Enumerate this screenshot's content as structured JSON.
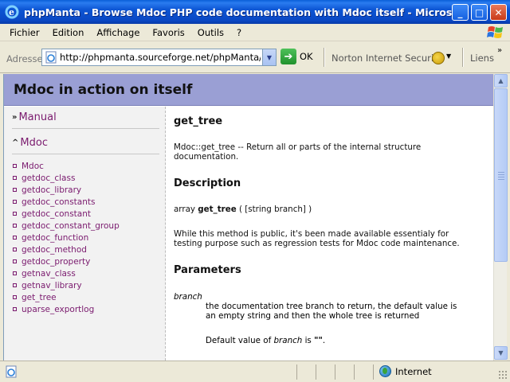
{
  "window": {
    "title": "phpManta - Browse Mdoc PHP code documentation with Mdoc itself - Microsoft Inter...",
    "buttons": {
      "minimize": "_",
      "maximize": "□",
      "close": "✕"
    }
  },
  "menubar": {
    "items": [
      "Fichier",
      "Edition",
      "Affichage",
      "Favoris",
      "Outils",
      "?"
    ]
  },
  "addressbar": {
    "label": "Adresse",
    "url": "http://phpmanta.sourceforge.net/phpManta/Mdoc/a",
    "go_label": "OK",
    "norton_label": "Norton Internet Security",
    "links_label": "Liens",
    "links_chevron": "»"
  },
  "page": {
    "header_title": "Mdoc in action on itself",
    "sidebar": {
      "manual_label": "Manual",
      "manual_glyph": "»",
      "mdoc_label": "Mdoc",
      "mdoc_glyph": "^",
      "items": [
        "Mdoc",
        "getdoc_class",
        "getdoc_library",
        "getdoc_constants",
        "getdoc_constant",
        "getdoc_constant_group",
        "getdoc_function",
        "getdoc_method",
        "getdoc_property",
        "getnav_class",
        "getnav_library",
        "get_tree",
        "uparse_exportlog"
      ]
    },
    "main": {
      "function_title": "get_tree",
      "summary_line1": "Mdoc::get_tree -- Return all or parts of the internal structure",
      "summary_line2": "documentation.",
      "description_heading": "Description",
      "signature_prefix": "array ",
      "signature_name": "get_tree",
      "signature_suffix": " ( [string branch] )",
      "desc_line1": "While this method is public, it's been made available essentialy for",
      "desc_line2": "testing purpose such as regression tests for Mdoc code maintenance.",
      "parameters_heading": "Parameters",
      "param_name": "branch",
      "param_desc_line1": "the documentation tree branch to return, the default value is",
      "param_desc_line2": "an empty string and then the whole tree is returned",
      "default_prefix": "Default value of ",
      "default_param": "branch",
      "default_mid": " is ",
      "default_value": "\"\"",
      "default_suffix": "."
    }
  },
  "statusbar": {
    "zone_label": "Internet"
  },
  "colors": {
    "titlebar": "#0a48c4",
    "header_band": "#9a9fd4",
    "link": "#7a1a6e",
    "sidebar_bg": "#f2f2f2"
  }
}
